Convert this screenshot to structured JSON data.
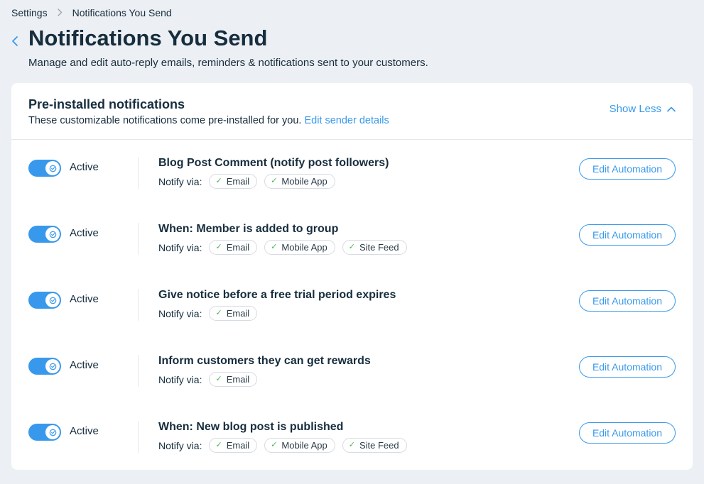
{
  "breadcrumb": {
    "root": "Settings",
    "current": "Notifications You Send"
  },
  "header": {
    "title": "Notifications You Send",
    "subtitle": "Manage and edit auto-reply emails, reminders & notifications sent to your customers."
  },
  "section": {
    "title": "Pre-installed notifications",
    "desc_prefix": "These customizable notifications come pre-installed for you. ",
    "edit_sender": "Edit sender details",
    "show_less": "Show Less"
  },
  "labels": {
    "active": "Active",
    "notify_via": "Notify via:",
    "edit_automation": "Edit Automation"
  },
  "channels": {
    "email": "Email",
    "mobile": "Mobile App",
    "feed": "Site Feed"
  },
  "rows": [
    {
      "title": "Blog Post Comment (notify post followers)",
      "channels": [
        "email",
        "mobile"
      ]
    },
    {
      "title": "When: Member is added to group",
      "channels": [
        "email",
        "mobile",
        "feed"
      ]
    },
    {
      "title": "Give notice before a free trial period expires",
      "channels": [
        "email"
      ]
    },
    {
      "title": "Inform customers they can get rewards",
      "channels": [
        "email"
      ]
    },
    {
      "title": "When: New blog post is published",
      "channels": [
        "email",
        "mobile",
        "feed"
      ]
    }
  ]
}
